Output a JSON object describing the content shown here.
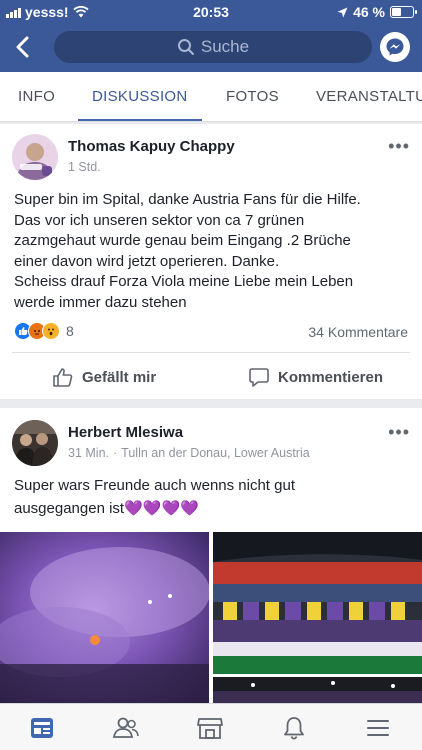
{
  "status": {
    "carrier": "yesss!",
    "time": "20:53",
    "battery_text": "46 %",
    "battery_level": 0.46
  },
  "search": {
    "placeholder": "Suche"
  },
  "tabs": [
    {
      "label": "INFO"
    },
    {
      "label": "DISKUSSION"
    },
    {
      "label": "FOTOS"
    },
    {
      "label": "VERANSTALTU"
    }
  ],
  "posts": [
    {
      "author": "Thomas Kapuy Chappy",
      "time": "1 Std.",
      "text_lines": [
        "Super bin im Spital, danke Austria Fans für die Hilfe.",
        "Das vor ich unseren  sektor von ca 7 grünen",
        "zazmgehaut wurde genau beim Eingang .2 Brüche",
        "einer davon wird  jetzt operieren. Danke.",
        "Scheiss drauf Forza Viola meine Liebe mein Leben",
        "werde immer dazu stehen"
      ],
      "reaction_count": "8",
      "comment_count": "34 Kommentare",
      "like_label": "Gefällt mir",
      "comment_label": "Kommentieren"
    },
    {
      "author": "Herbert Mlesiwa",
      "time": "31 Min.",
      "location": "Tulln an der Donau, Lower Austria",
      "text_lines": [
        "Super wars Freunde auch wenns nicht gut",
        "ausgegangen ist💜💜💜💜"
      ]
    }
  ],
  "colors": {
    "brand": "#3b5998",
    "tab_active": "#4267b2",
    "text": "#1d2129",
    "secondary": "#90949c"
  }
}
